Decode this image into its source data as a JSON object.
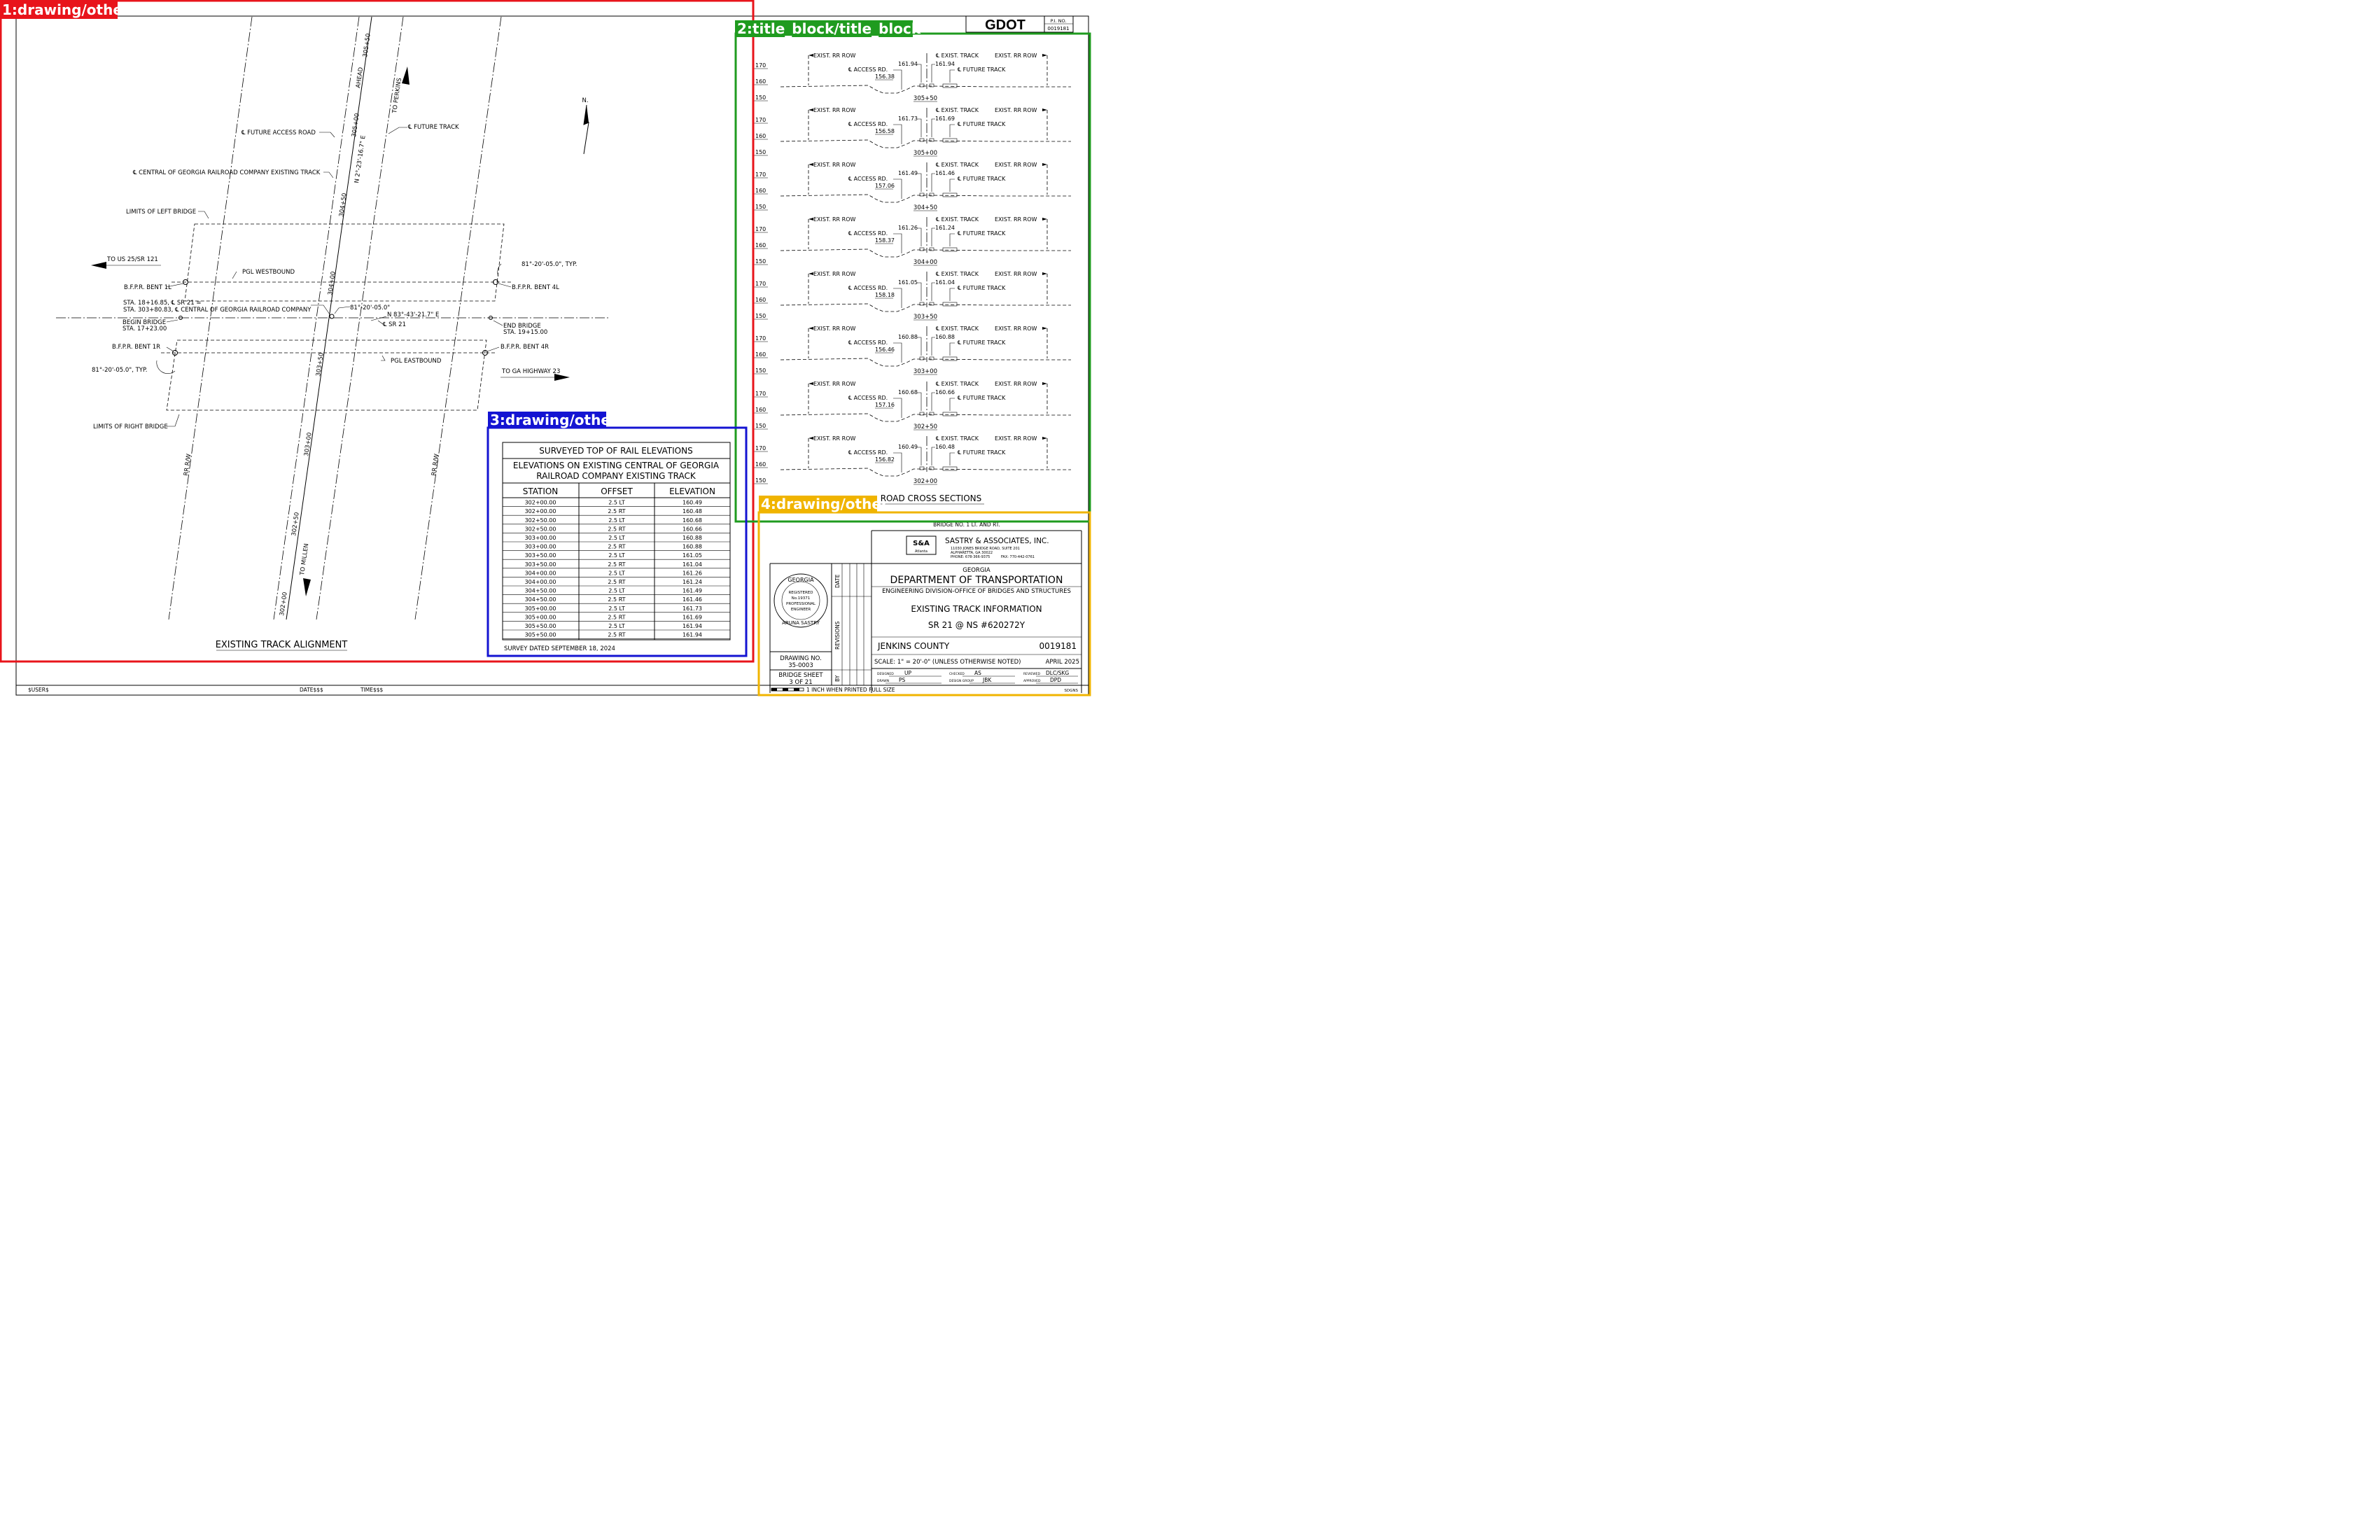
{
  "overlay_labels": [
    "1:drawing/other",
    "2:title_block/title_block",
    "3:drawing/other",
    "4:drawing/other"
  ],
  "overlay_colors": [
    "#e8141b",
    "#1f9b1f",
    "#1414d2",
    "#f0b400"
  ],
  "corner": {
    "logo": "GDOT",
    "pi_label": "P.I. NO.",
    "pi_number": "0019181"
  },
  "plan": {
    "title": "EXISTING TRACK ALIGNMENT",
    "north": "N.",
    "labels": {
      "future_access_road": "℄ FUTURE ACCESS ROAD",
      "future_track": "℄ FUTURE TRACK",
      "central_track": "℄ CENTRAL OF GEORGIA RAILROAD COMPANY EXISTING TRACK",
      "limits_left": "LIMITS OF LEFT BRIDGE",
      "limits_right": "LIMITS OF RIGHT BRIDGE",
      "to_us25": "TO US 25/SR 121",
      "to_ga23": "TO GA HIGHWAY 23",
      "to_perkins": "TO PERKINS",
      "to_millen": "TO MILLEN",
      "ahead": "AHEAD",
      "pgl_wb": "PGL WESTBOUND",
      "pgl_eb": "PGL EASTBOUND",
      "bent_1l": "B.F.P.R. BENT 1L",
      "bent_4l": "B.F.P.R. BENT 4L",
      "bent_1r": "B.F.P.R. BENT 1R",
      "bent_4r": "B.F.P.R. BENT 4R",
      "skew_typ_right": "81°-20'-05.0\", TYP.",
      "skew_typ_left": "81°-20'-05.0\", TYP.",
      "skew": "81°-20'-05.0\"",
      "sta_eq_1": "STA. 18+16.85, ℄ SR 21 =",
      "sta_eq_2": "STA. 303+80.83, ℄ CENTRAL OF GEORGIA RAILROAD COMPANY",
      "begin_bridge_1": "BEGIN BRIDGE",
      "begin_bridge_2": "STA. 17+23.00",
      "end_bridge_1": "END BRIDGE",
      "end_bridge_2": "STA. 19+15.00",
      "bearing_sr21": "N 83°-43'-21.7\" E",
      "bearing_track": "N 2°-23'-16.7\" E",
      "cl_sr21": "℄ SR 21",
      "rr_rw": "RR R/W"
    },
    "stations": [
      "305+50",
      "305+00",
      "304+50",
      "304+00",
      "303+50",
      "303+00",
      "302+50",
      "302+00"
    ]
  },
  "sections": {
    "title": "ROAD CROSS SECTIONS",
    "exist_rr_row": "EXIST. RR ROW",
    "exist_track": "℄ EXIST. TRACK",
    "access_rd": "℄ ACCESS RD.",
    "future_track": "℄ FUTURE TRACK",
    "elev_ticks": [
      "170",
      "160",
      "150"
    ],
    "items": [
      {
        "station": "305+50",
        "left": "161.94",
        "right": "161.94",
        "low": "156.38"
      },
      {
        "station": "305+00",
        "left": "161.73",
        "right": "161.69",
        "low": "156.58"
      },
      {
        "station": "304+50",
        "left": "161.49",
        "right": "161.46",
        "low": "157.06"
      },
      {
        "station": "304+00",
        "left": "161.26",
        "right": "161.24",
        "low": "158.37"
      },
      {
        "station": "303+50",
        "left": "161.05",
        "right": "161.04",
        "low": "158.18"
      },
      {
        "station": "303+00",
        "left": "160.88",
        "right": "160.88",
        "low": "156.46"
      },
      {
        "station": "302+50",
        "left": "160.68",
        "right": "160.66",
        "low": "157.16"
      },
      {
        "station": "302+00",
        "left": "160.49",
        "right": "160.48",
        "low": "156.82"
      }
    ]
  },
  "table": {
    "title": "SURVEYED TOP OF RAIL ELEVATIONS",
    "subtitle_1": "ELEVATIONS ON EXISTING CENTRAL OF GEORGIA",
    "subtitle_2": "RAILROAD COMPANY EXISTING TRACK",
    "headers": [
      "STATION",
      "OFFSET",
      "ELEVATION"
    ],
    "rows": [
      [
        "302+00.00",
        "2.5 LT",
        "160.49"
      ],
      [
        "302+00.00",
        "2.5 RT",
        "160.48"
      ],
      [
        "302+50.00",
        "2.5 LT",
        "160.68"
      ],
      [
        "302+50.00",
        "2.5 RT",
        "160.66"
      ],
      [
        "303+00.00",
        "2.5 LT",
        "160.88"
      ],
      [
        "303+00.00",
        "2.5 RT",
        "160.88"
      ],
      [
        "303+50.00",
        "2.5 LT",
        "161.05"
      ],
      [
        "303+50.00",
        "2.5 RT",
        "161.04"
      ],
      [
        "304+00.00",
        "2.5 LT",
        "161.26"
      ],
      [
        "304+00.00",
        "2.5 RT",
        "161.24"
      ],
      [
        "304+50.00",
        "2.5 LT",
        "161.49"
      ],
      [
        "304+50.00",
        "2.5 RT",
        "161.46"
      ],
      [
        "305+00.00",
        "2.5 LT",
        "161.73"
      ],
      [
        "305+00.00",
        "2.5 RT",
        "161.69"
      ],
      [
        "305+50.00",
        "2.5 LT",
        "161.94"
      ],
      [
        "305+50.00",
        "2.5 RT",
        "161.94"
      ]
    ],
    "footer": "SURVEY DATED SEPTEMBER 18, 2024"
  },
  "title_block": {
    "bridge_no": "BRIDGE NO. 1 LT. AND RT.",
    "firm_logo": "S&A",
    "firm_logo_sub": "Atlanta",
    "firm_name": "SASTRY & ASSOCIATES, INC.",
    "firm_addr_1": "11030 JONES BRIDGE ROAD, SUITE 201",
    "firm_addr_2": "ALPHARETTA, GA 30022",
    "firm_phone": "PHONE: 678-366-9375",
    "firm_fax": "FAX: 770-442-0761",
    "state": "GEORGIA",
    "dept": "DEPARTMENT OF TRANSPORTATION",
    "division": "ENGINEERING DIVISION-OFFICE OF BRIDGES AND STRUCTURES",
    "sheet_title": "EXISTING TRACK INFORMATION",
    "project": "SR 21 @ NS #620272Y",
    "county": "JENKINS COUNTY",
    "pi": "0019181",
    "scale": "SCALE: 1\" = 20'-0\" (UNLESS OTHERWISE NOTED)",
    "date": "APRIL 2025",
    "drawing_no_label": "DRAWING NO.",
    "drawing_no": "35-0003",
    "bridge_sheet_label": "BRIDGE SHEET",
    "bridge_sheet": "3 OF 21",
    "col_date": "DATE",
    "col_revisions": "REVISIONS",
    "col_by": "BY",
    "seal_top": "GEORGIA",
    "seal_reg": "REGISTERED",
    "seal_no": "No.19371",
    "seal_prof": "PROFESSIONAL",
    "seal_eng": "ENGINEER",
    "seal_name": "ARUNA SASTRY",
    "designed_label": "DESIGNED",
    "designed": "UP",
    "drawn_label": "DRAWN",
    "drawn": "PS",
    "checked_label": "CHECKED",
    "checked": "AS",
    "design_group_label": "DESIGN GROUP",
    "design_group": "JBK",
    "reviewed_label": "REVIEWED",
    "reviewed": "DLC/SKG",
    "approved_label": "APPROVED",
    "approved": "DPD",
    "inch_note": "1 INCH WHEN PRINTED FULL SIZE",
    "sdgns": "SDGNS"
  },
  "footer": {
    "user": "$USER$",
    "date": "DATE$$$",
    "time": "TIME$$$"
  }
}
